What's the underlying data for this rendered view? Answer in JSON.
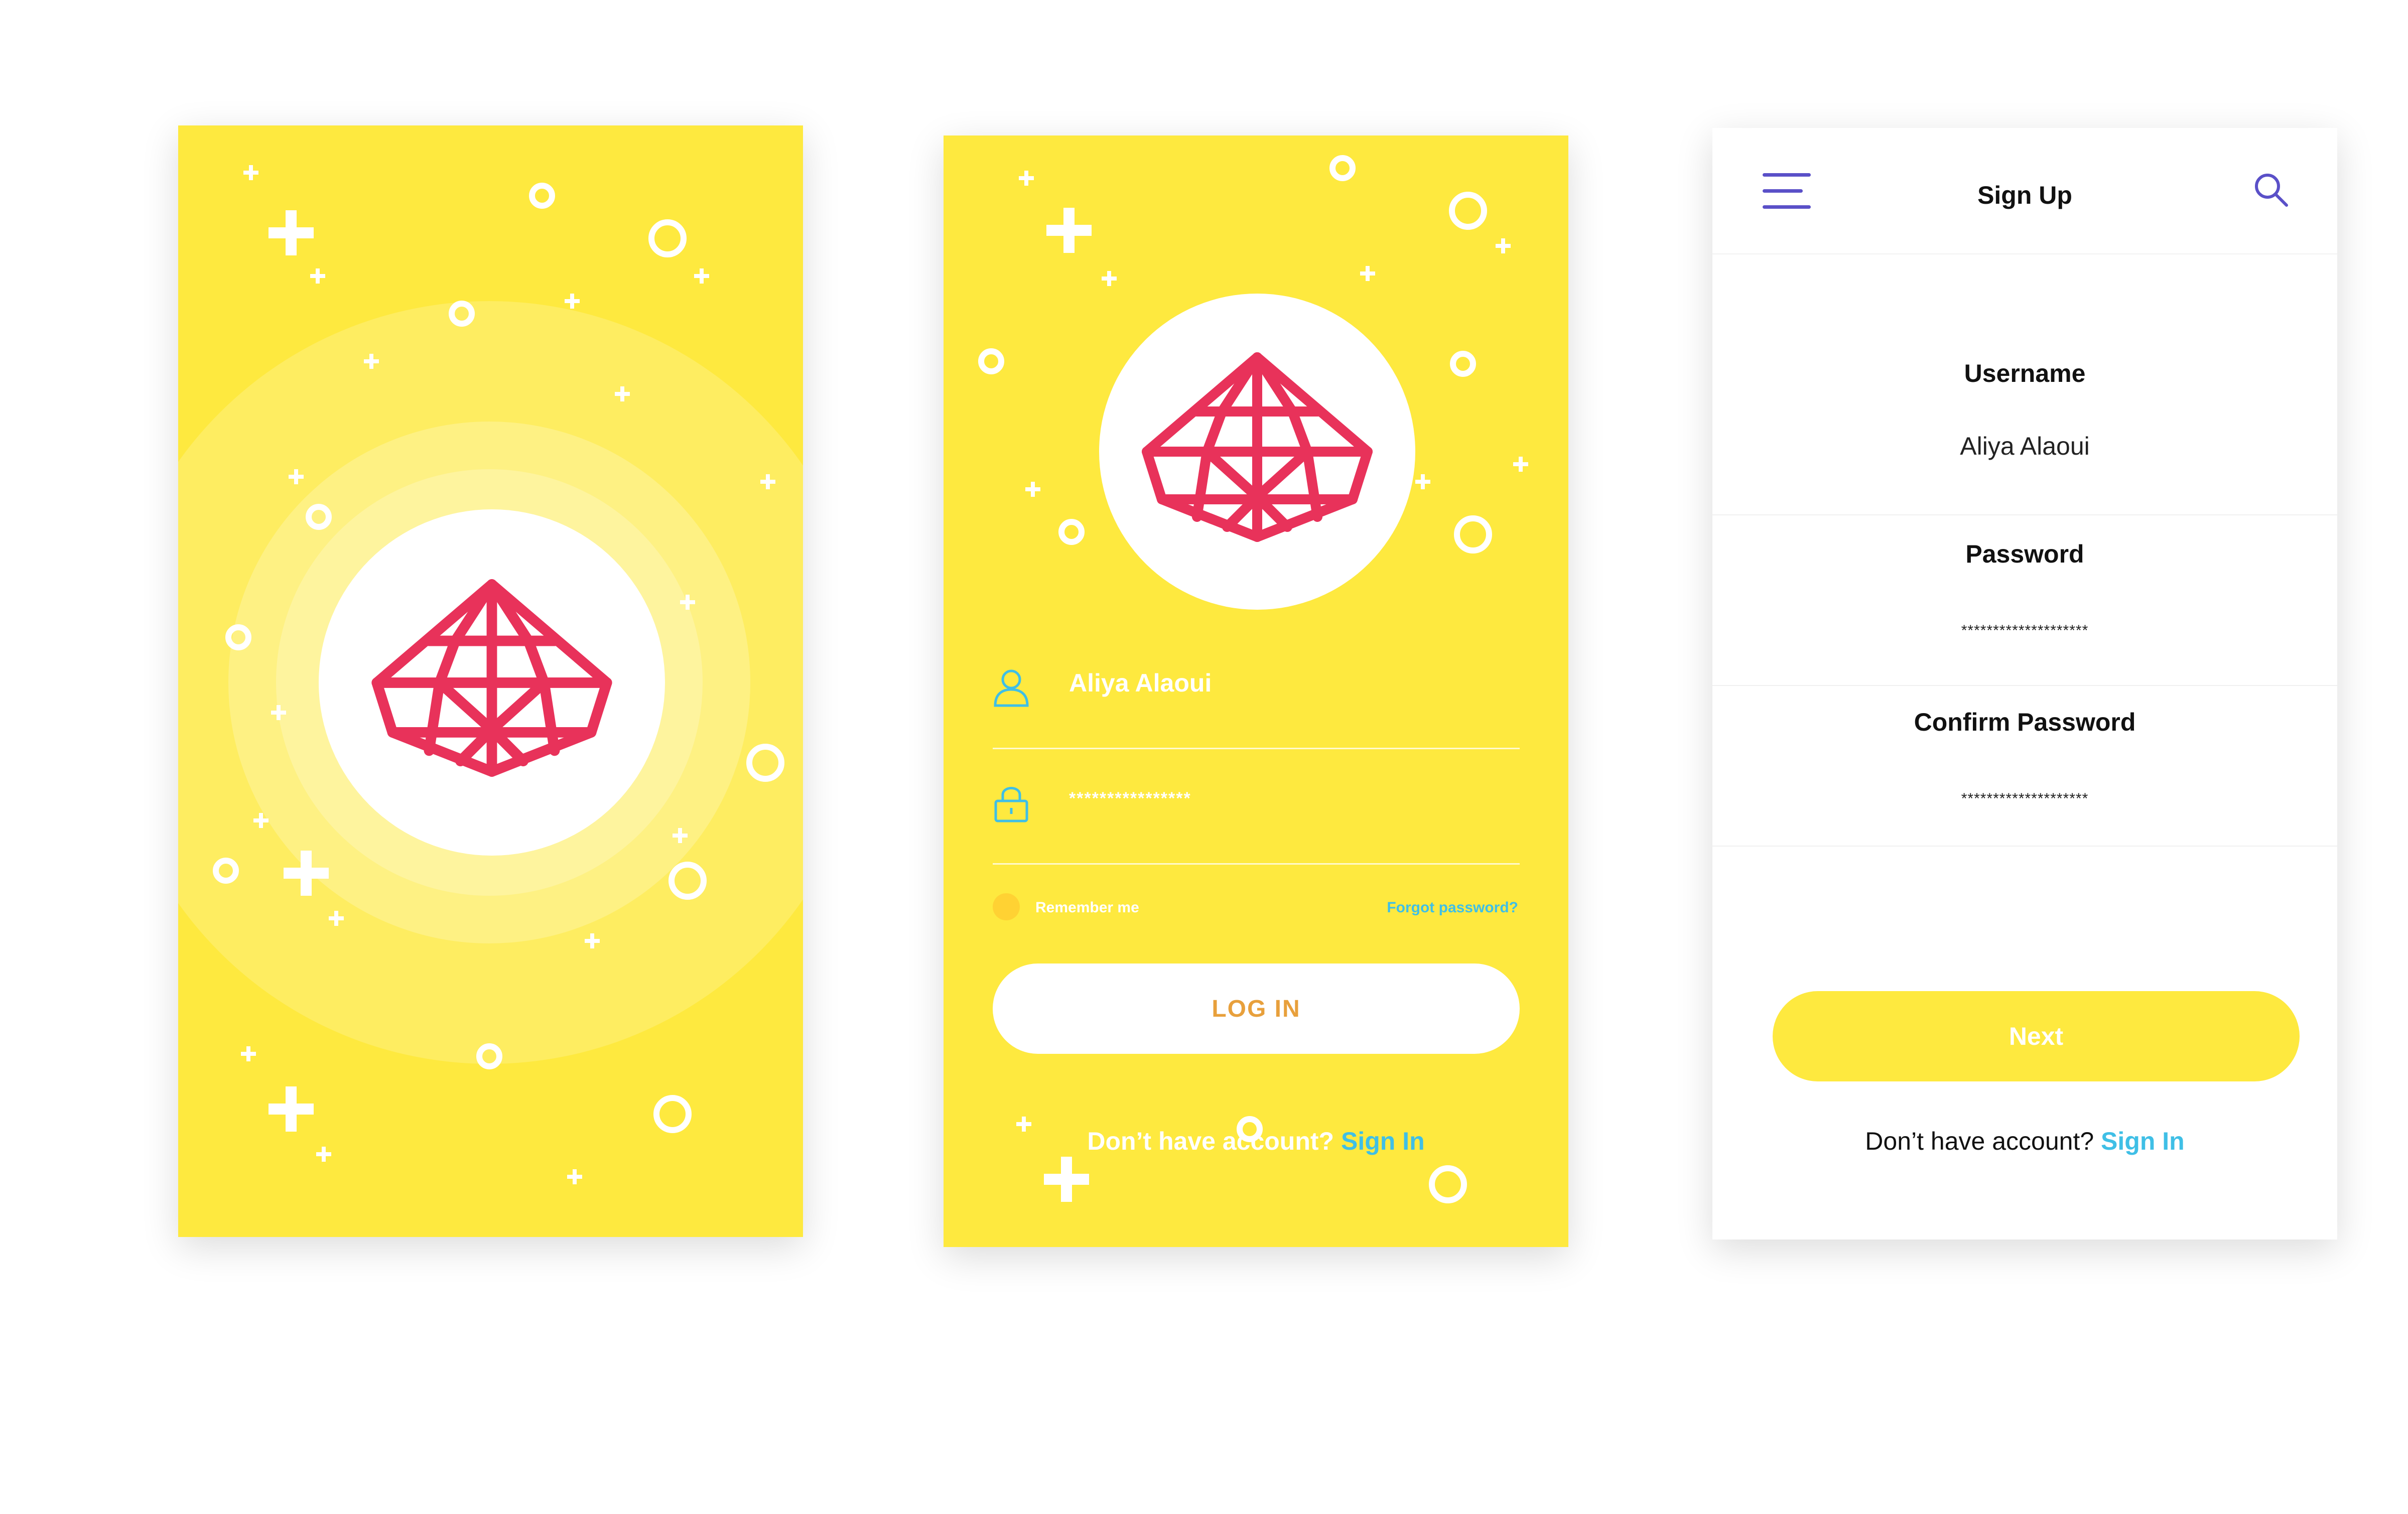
{
  "colors": {
    "background_yellow": "#FEE93F",
    "gem_red": "#E8325A",
    "link_blue": "#3FBFE6",
    "login_button_text": "#E8A03C",
    "menu_purple": "#5A50C8"
  },
  "splash": {
    "logo": "red-gem-logo"
  },
  "login": {
    "logo": "red-gem-logo",
    "username": {
      "icon": "user-icon",
      "value": "Aliya Alaoui"
    },
    "password": {
      "icon": "lock-icon",
      "value": "****************"
    },
    "remember_me": "Remember me",
    "forgot_password": "Forgot password?",
    "login_button": "LOG IN",
    "no_account_text": "Don’t have account?",
    "sign_in_link": "Sign In"
  },
  "signup": {
    "title": "Sign Up",
    "menu_icon": "menu-icon",
    "search_icon": "search-icon",
    "username_label": "Username",
    "username_value": "Aliya Alaoui",
    "password_label": "Password",
    "password_value": "********************",
    "confirm_label": "Confirm Password",
    "confirm_value": "********************",
    "next_button": "Next",
    "no_account_text": "Don’t have account?",
    "sign_in_link": "Sign In"
  }
}
